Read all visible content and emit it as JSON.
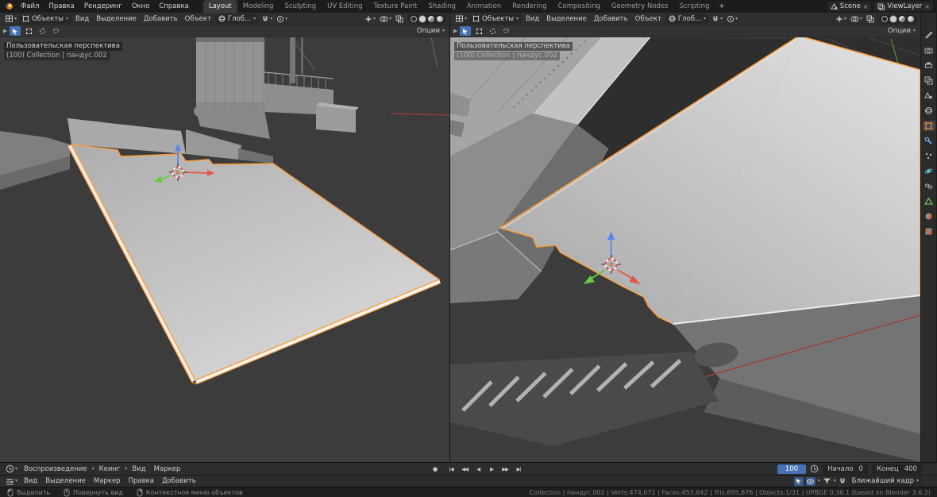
{
  "topbar": {
    "menus": [
      "Файл",
      "Правка",
      "Рендеринг",
      "Окно",
      "Справка"
    ],
    "workspaces": [
      "Layout",
      "Modeling",
      "Sculpting",
      "UV Editing",
      "Texture Paint",
      "Shading",
      "Animation",
      "Rendering",
      "Compositing",
      "Geometry Nodes",
      "Scripting"
    ],
    "add_workspace": "+",
    "scene_name": "Scene",
    "viewlayer_name": "ViewLayer"
  },
  "viewport_left": {
    "mode": "Объекты",
    "menu_view": "Вид",
    "menu_select": "Выделение",
    "menu_add": "Добавить",
    "menu_object": "Объект",
    "orientation": "Глоб...",
    "options": "Опции",
    "overlay_perspective": "Пользовательская перспектива",
    "overlay_collection": "(100) Collection | пандус.002"
  },
  "viewport_right": {
    "mode": "Объекты",
    "menu_view": "Вид",
    "menu_select": "Выделение",
    "menu_add": "Добавить",
    "menu_object": "Объект",
    "orientation": "Глоб...",
    "options": "Опции",
    "overlay_perspective": "Пользовательская перспектива",
    "overlay_collection": "(100) Collection | пандус.002"
  },
  "timeline": {
    "menu_playback": "Воспроизведение",
    "menu_keying": "Кеинг",
    "menu_view": "Вид",
    "menu_marker": "Маркер",
    "record": "●",
    "transport": [
      "|◀",
      "◀◀",
      "◀",
      "▶",
      "▶▶",
      "▶|"
    ],
    "current_frame": "100",
    "start_label": "Начало",
    "start_value": "0",
    "end_label": "Конец",
    "end_value": "400"
  },
  "dopesheet": {
    "menu_view": "Вид",
    "menu_select": "Выделение",
    "menu_marker": "Маркер",
    "menu_edit": "Правка",
    "menu_add": "Добавить",
    "snap_mode": "Ближайший кадр"
  },
  "statusbar": {
    "hint_select": "Выделить",
    "hint_rotate": "Повернуть вид",
    "hint_context": "Контекстное меню объектов",
    "stats": "Collection | пандус.002 | Verts:474,071 | Faces:453,642 | Tris:895,876 | Objects:1/31 | UPBGE 0.36.1 (based on Blender 3.6.2)"
  },
  "properties_tabs": [
    "tool",
    "render",
    "output",
    "view-layer",
    "scene",
    "world",
    "object",
    "modifiers",
    "particles",
    "physics",
    "constraints",
    "object-data",
    "material",
    "texture"
  ],
  "colors": {
    "selection_outline": "#ff9d38",
    "axis_x": "#e8544a",
    "axis_y": "#66cc44",
    "axis_z": "#5a86e8",
    "frame_field": "#4772b3"
  }
}
